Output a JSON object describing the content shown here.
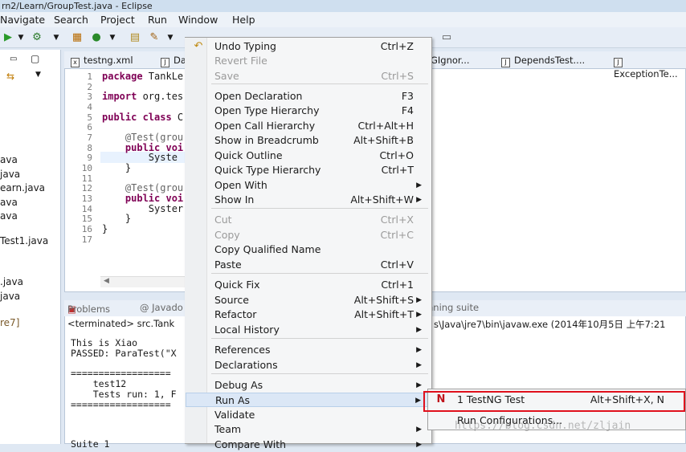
{
  "window": {
    "title": "rn2/Learn/GroupTest.java - Eclipse"
  },
  "menubar": [
    "Navigate",
    "Search",
    "Project",
    "Run",
    "Window",
    "Help"
  ],
  "left_pane": {
    "items": [
      "ava",
      "java",
      "earn.java",
      "ava",
      "ava",
      "Test1.java",
      ".java",
      "java",
      "re7]"
    ]
  },
  "editor": {
    "tabs": [
      "testng.xml",
      "Da",
      "GIgnor...",
      "DependsTest....",
      "ExceptionTe..."
    ],
    "line_numbers": [
      "1",
      "2",
      "3",
      "4",
      "5",
      "6",
      "7",
      "8",
      "9",
      "10",
      "11",
      "12",
      "13",
      "14",
      "15",
      "16",
      "17"
    ],
    "code": {
      "l1_kw": "package",
      "l1_rest": " TankLe",
      "l3_kw": "import",
      "l3_rest": " org.tes",
      "l5_kw": "public class",
      "l5_rest": " C",
      "l7": "    @Test(grou",
      "l8_kw": "    public voi",
      "l9": "        Syste",
      "l10": "    }",
      "l12": "    @Test(grou",
      "l13_kw": "    public voi",
      "l14": "        Syster",
      "l15": "    }",
      "l16": "}"
    }
  },
  "console": {
    "tabs": [
      "Problems",
      "@ Javado",
      "nning suite"
    ],
    "header_left": "<terminated> src.Tank",
    "header_right": "s\\Java\\jre7\\bin\\javaw.exe (2014年10月5日 上午7:21",
    "lines": [
      "This is Xiao",
      "PASSED: ParaTest(\"X",
      "",
      "==================",
      "    test12",
      "    Tests run: 1, F",
      "==================",
      "",
      "Suite 1"
    ]
  },
  "context_menu": {
    "items": [
      {
        "label": "Undo Typing",
        "shortcut": "Ctrl+Z",
        "icon": "undo-icon"
      },
      {
        "label": "Revert File",
        "shortcut": "",
        "disabled": true
      },
      {
        "label": "Save",
        "shortcut": "Ctrl+S",
        "disabled": true
      },
      {
        "label": "Open Declaration",
        "shortcut": "F3"
      },
      {
        "label": "Open Type Hierarchy",
        "shortcut": "F4"
      },
      {
        "label": "Open Call Hierarchy",
        "shortcut": "Ctrl+Alt+H"
      },
      {
        "label": "Show in Breadcrumb",
        "shortcut": "Alt+Shift+B"
      },
      {
        "label": "Quick Outline",
        "shortcut": "Ctrl+O"
      },
      {
        "label": "Quick Type Hierarchy",
        "shortcut": "Ctrl+T"
      },
      {
        "label": "Open With",
        "shortcut": "",
        "submenu": true
      },
      {
        "label": "Show In",
        "shortcut": "Alt+Shift+W",
        "submenu": true
      },
      {
        "label": "Cut",
        "shortcut": "Ctrl+X",
        "disabled": true
      },
      {
        "label": "Copy",
        "shortcut": "Ctrl+C",
        "disabled": true
      },
      {
        "label": "Copy Qualified Name",
        "shortcut": ""
      },
      {
        "label": "Paste",
        "shortcut": "Ctrl+V"
      },
      {
        "label": "Quick Fix",
        "shortcut": "Ctrl+1"
      },
      {
        "label": "Source",
        "shortcut": "Alt+Shift+S",
        "submenu": true
      },
      {
        "label": "Refactor",
        "shortcut": "Alt+Shift+T",
        "submenu": true
      },
      {
        "label": "Local History",
        "shortcut": "",
        "submenu": true
      },
      {
        "label": "References",
        "shortcut": "",
        "submenu": true
      },
      {
        "label": "Declarations",
        "shortcut": "",
        "submenu": true
      },
      {
        "label": "Debug As",
        "shortcut": "",
        "submenu": true
      },
      {
        "label": "Run As",
        "shortcut": "",
        "submenu": true,
        "active": true
      },
      {
        "label": "Validate",
        "shortcut": ""
      },
      {
        "label": "Team",
        "shortcut": "",
        "submenu": true
      },
      {
        "label": "Compare With",
        "shortcut": "",
        "submenu": true
      }
    ]
  },
  "run_as_submenu": {
    "items": [
      {
        "label": "1 TestNG Test",
        "shortcut": "Alt+Shift+X, N",
        "icon": "testng-icon"
      },
      {
        "label": "Run Configurations...",
        "shortcut": ""
      }
    ]
  },
  "watermark": "https://blog.csdn.net/zljain",
  "colors": {
    "highlight_border": "#e0101c",
    "keyword": "#7f0055"
  }
}
